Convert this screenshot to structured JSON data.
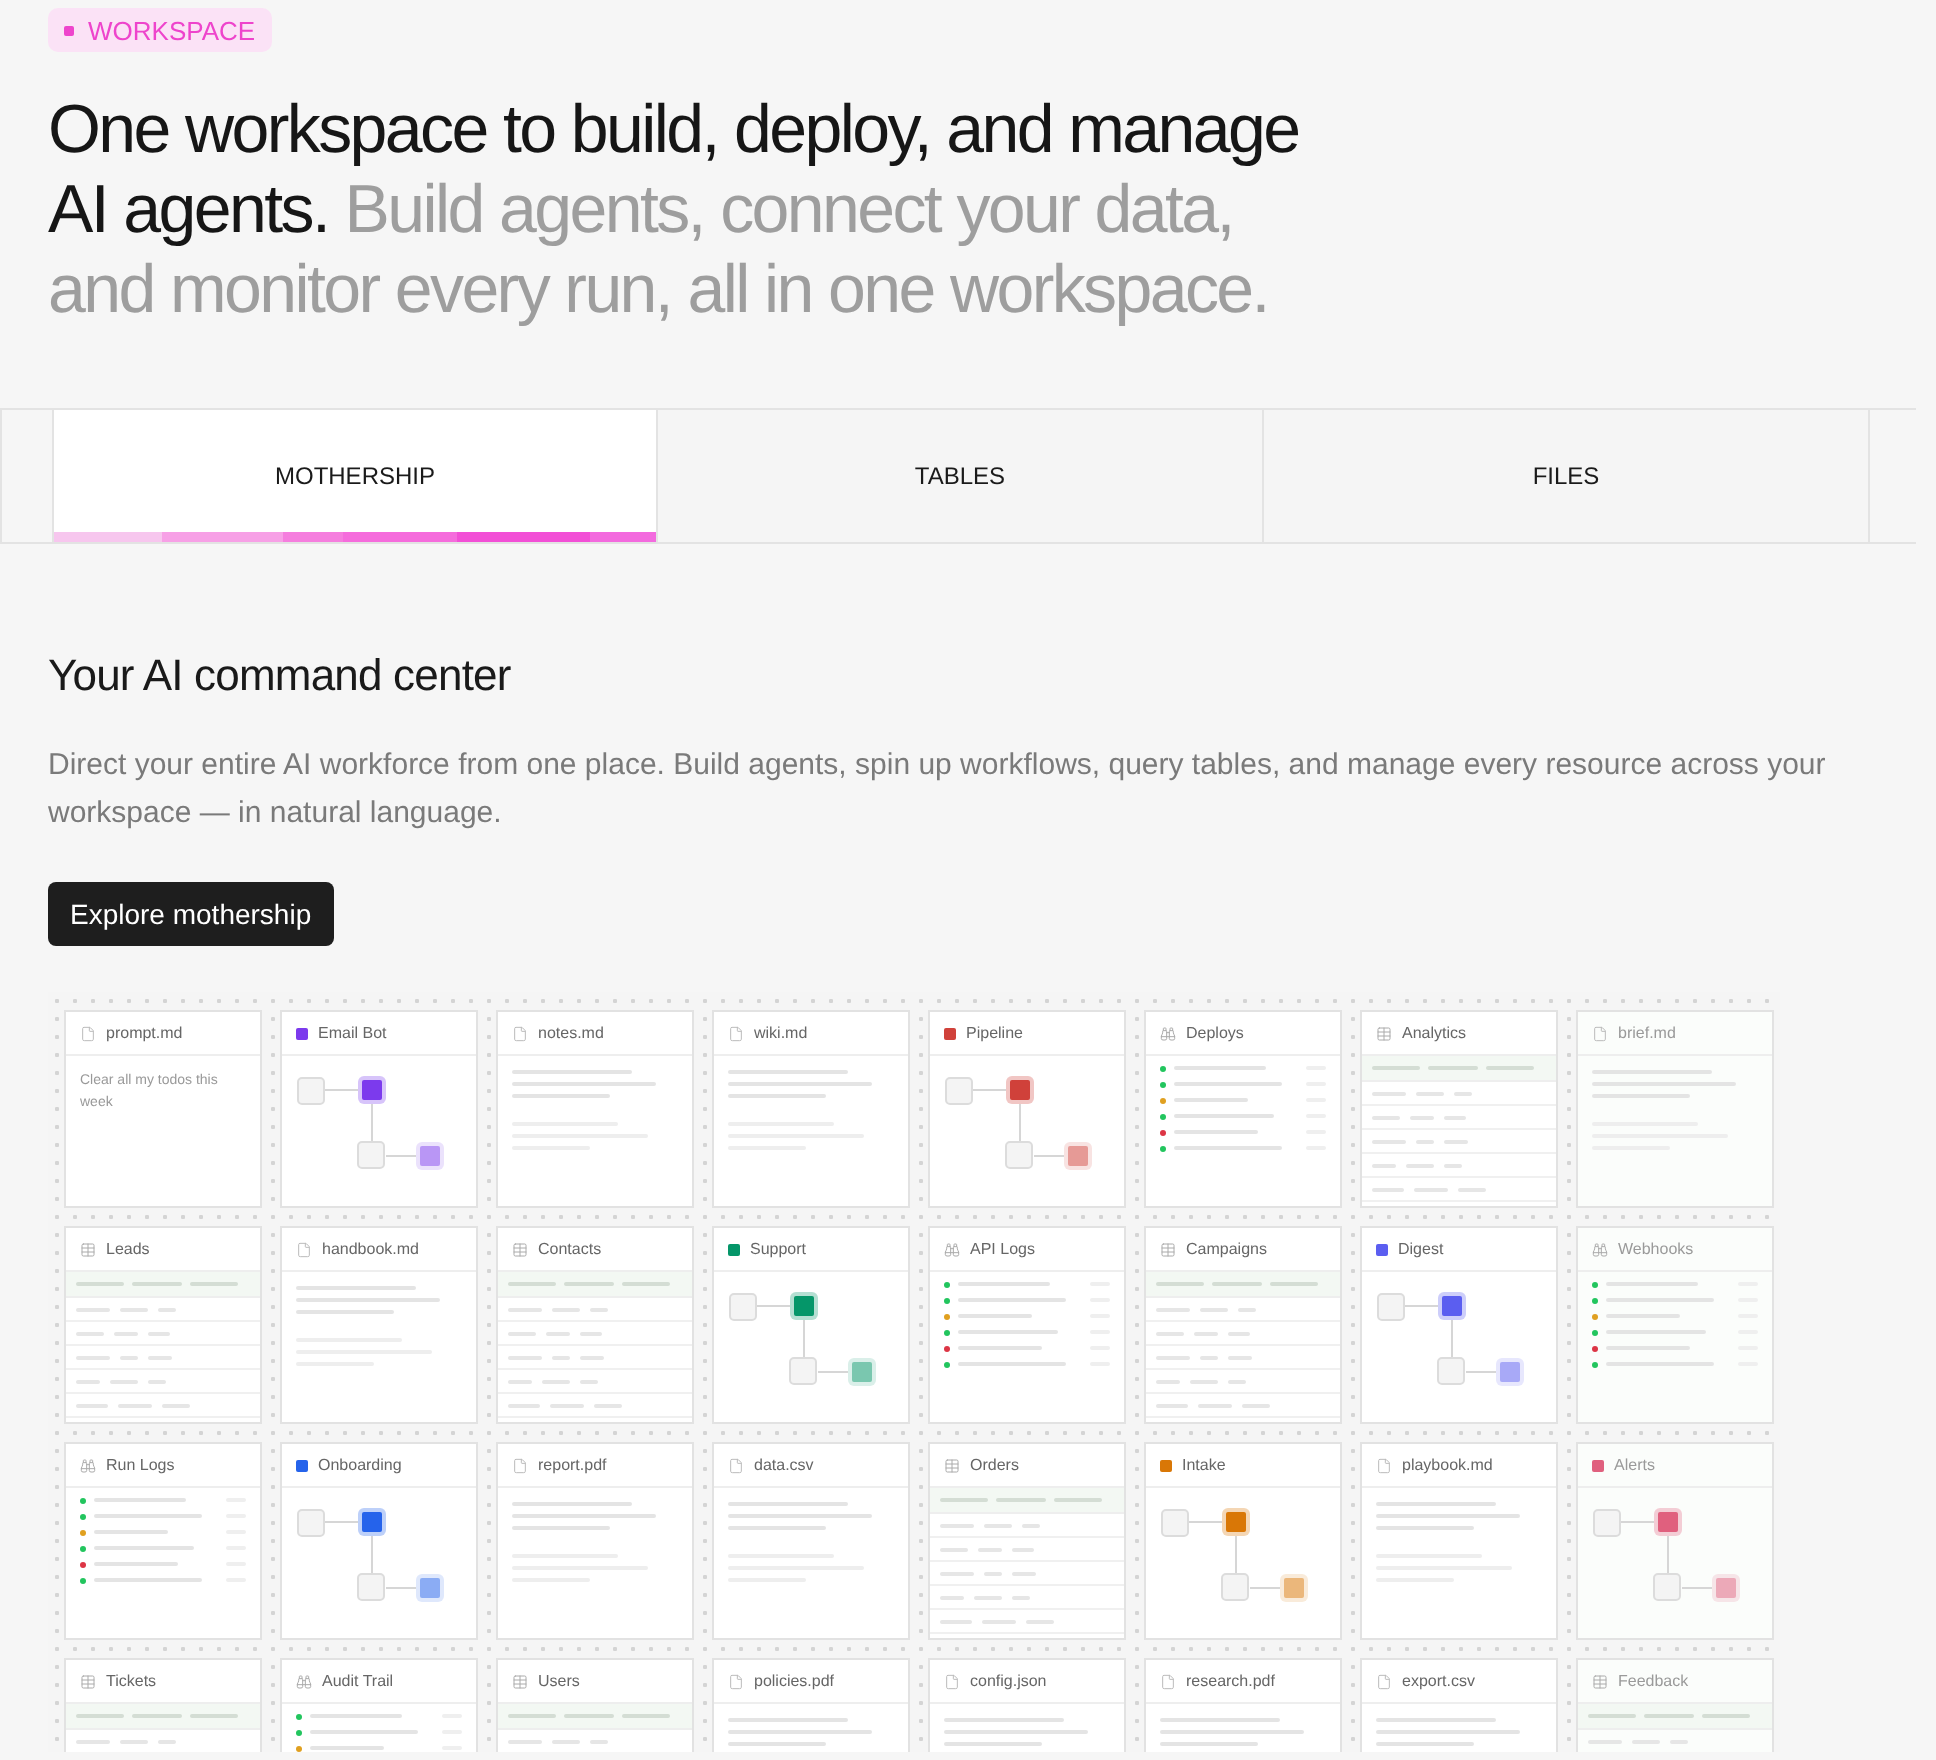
{
  "badge": "WORKSPACE",
  "headline": {
    "lead": "One workspace to build, deploy, and manage AI agents.",
    "rest": "Build agents, connect your data, and monitor every run, all in one workspace."
  },
  "tabs": [
    {
      "label": "MOTHERSHIP",
      "selected": true
    },
    {
      "label": "TABLES",
      "selected": false
    },
    {
      "label": "FILES",
      "selected": false
    }
  ],
  "section": {
    "title": "Your AI command center",
    "description": "Direct your entire AI workforce from one place. Build agents, spin up workflows, query tables, and manage every resource across your workspace — in natural language.",
    "button": "Explore mothership"
  },
  "cards": [
    {
      "kind": "prompt",
      "title": "prompt.md",
      "text": "Clear all my todos this week"
    },
    {
      "kind": "agent",
      "title": "Email Bot",
      "color": "#7c3aed"
    },
    {
      "kind": "doc",
      "title": "notes.md"
    },
    {
      "kind": "doc",
      "title": "wiki.md"
    },
    {
      "kind": "agent",
      "title": "Pipeline",
      "color": "#d0413a"
    },
    {
      "kind": "logs",
      "title": "Deploys",
      "dots": [
        {
          "color": "#22c55e"
        },
        {
          "color": "#22c55e"
        },
        {
          "color": "#e0a020"
        },
        {
          "color": "#22c55e"
        },
        {
          "color": "#dc3545"
        },
        {
          "color": "#22c55e"
        }
      ]
    },
    {
      "kind": "table",
      "title": "Analytics"
    },
    {
      "kind": "doc",
      "title": "brief.md"
    },
    {
      "kind": "table",
      "title": "Leads"
    },
    {
      "kind": "doc",
      "title": "handbook.md"
    },
    {
      "kind": "table",
      "title": "Contacts"
    },
    {
      "kind": "agent",
      "title": "Support",
      "color": "#059669"
    },
    {
      "kind": "logs",
      "title": "API Logs",
      "dots": [
        {
          "color": "#22c55e"
        },
        {
          "color": "#22c55e"
        },
        {
          "color": "#e0a020"
        },
        {
          "color": "#22c55e"
        },
        {
          "color": "#dc3545"
        },
        {
          "color": "#22c55e"
        }
      ]
    },
    {
      "kind": "table",
      "title": "Campaigns"
    },
    {
      "kind": "agent",
      "title": "Digest",
      "color": "#5b5ef0"
    },
    {
      "kind": "logs",
      "title": "Webhooks",
      "dots": [
        {
          "color": "#22c55e"
        },
        {
          "color": "#22c55e"
        },
        {
          "color": "#e0a020"
        },
        {
          "color": "#22c55e"
        },
        {
          "color": "#dc3545"
        },
        {
          "color": "#22c55e"
        }
      ]
    },
    {
      "kind": "logs",
      "title": "Run Logs",
      "dots": [
        {
          "color": "#22c55e"
        },
        {
          "color": "#22c55e"
        },
        {
          "color": "#e0a020"
        },
        {
          "color": "#22c55e"
        },
        {
          "color": "#dc3545"
        },
        {
          "color": "#22c55e"
        }
      ]
    },
    {
      "kind": "agent",
      "title": "Onboarding",
      "color": "#2563eb"
    },
    {
      "kind": "doc",
      "title": "report.pdf"
    },
    {
      "kind": "doc",
      "title": "data.csv"
    },
    {
      "kind": "table",
      "title": "Orders"
    },
    {
      "kind": "agent",
      "title": "Intake",
      "color": "#d97706"
    },
    {
      "kind": "doc",
      "title": "playbook.md"
    },
    {
      "kind": "agent",
      "title": "Alerts",
      "color": "#e0607e"
    },
    {
      "kind": "table",
      "title": "Tickets"
    },
    {
      "kind": "logs",
      "title": "Audit Trail",
      "dots": [
        {
          "color": "#22c55e"
        },
        {
          "color": "#22c55e"
        },
        {
          "color": "#e0a020"
        }
      ]
    },
    {
      "kind": "table",
      "title": "Users"
    },
    {
      "kind": "doc",
      "title": "policies.pdf"
    },
    {
      "kind": "doc",
      "title": "config.json"
    },
    {
      "kind": "doc",
      "title": "research.pdf"
    },
    {
      "kind": "doc",
      "title": "export.csv"
    },
    {
      "kind": "table",
      "title": "Feedback"
    }
  ]
}
